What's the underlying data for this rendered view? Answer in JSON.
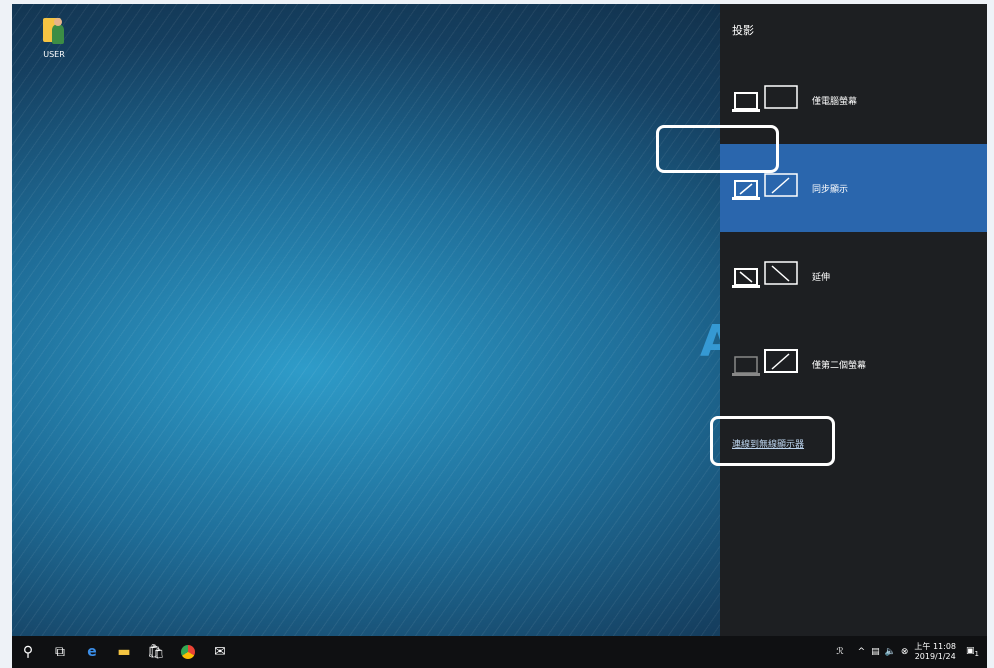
{
  "desktop": {
    "icon_label": "USER",
    "watermark": "A"
  },
  "panel": {
    "title": "投影",
    "options": [
      {
        "label": "僅電腦螢幕",
        "selected": false
      },
      {
        "label": "同步顯示",
        "selected": true
      },
      {
        "label": "延伸",
        "selected": false
      },
      {
        "label": "僅第二個螢幕",
        "selected": false
      }
    ],
    "connect_link": "連線到無線顯示器"
  },
  "taskbar": {
    "icons": [
      "search-icon",
      "task-view-icon",
      "edge-icon",
      "file-explorer-icon",
      "store-icon",
      "chrome-icon",
      "mail-icon"
    ],
    "tray": {
      "time": "上午 11:08",
      "date": "2019/1/24",
      "notification_count": "1"
    }
  },
  "colors": {
    "selected": "#2a66ad",
    "panel_bg": "#1d1f22",
    "highlight_border": "#ffffff"
  }
}
